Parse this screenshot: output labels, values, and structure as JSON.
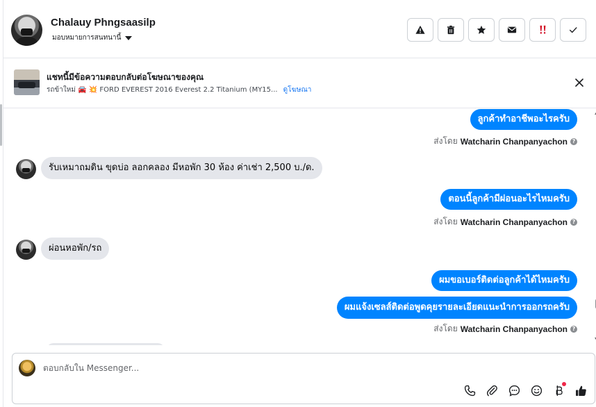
{
  "header": {
    "contact_name": "Chalauy Phngsaasilp",
    "assign_label": "มอบหมายการสนทนานี้",
    "actions": [
      {
        "name": "report",
        "icon": "warning-icon"
      },
      {
        "name": "delete",
        "icon": "trash-icon"
      },
      {
        "name": "star",
        "icon": "star-icon"
      },
      {
        "name": "mark-unread",
        "icon": "envelope-icon"
      },
      {
        "name": "follow-up",
        "icon": "exclamation-icon"
      },
      {
        "name": "mark-done",
        "icon": "check-icon"
      }
    ]
  },
  "ad_banner": {
    "title": "แชทนี้มีข้อความตอบกลับต่อโฆษณาของคุณ",
    "subtitle": "รถข้าใหม่ 🚘 💥 FORD EVEREST 2016 Everest 2.2 Titanium (MY15...",
    "link": "ดูโฆษณา"
  },
  "thread": {
    "messages": [
      {
        "dir": "out",
        "text": "ลูกค้าทำอาชีพอะไรครับ"
      },
      {
        "dir": "sent_by",
        "label": "ส่งโดย",
        "agent": "Watcharin Chanpanyachon"
      },
      {
        "dir": "in",
        "text": "รับเหมาถมดิน ขุดบ่อ ลอกคลอง มีหอพัก 30 ห้อง ค่าเช่า 2,500 บ./ด."
      },
      {
        "dir": "out",
        "text": "ตอนนี้ลูกค้ามีผ่อนอะไรไหมครับ"
      },
      {
        "dir": "sent_by",
        "label": "ส่งโดย",
        "agent": "Watcharin Chanpanyachon"
      },
      {
        "dir": "in",
        "text": "ผ่อนหอพัก/รถ"
      },
      {
        "dir": "out",
        "text": "ผมขอเบอร์ติดต่อลูกค้าได้ไหมครับ"
      },
      {
        "dir": "out",
        "text": "ผมแจ้งเซลส์ติดต่อพูดคุยรายละเอียดแนะนำการออกรถครับ"
      },
      {
        "dir": "sent_by",
        "label": "ส่งโดย",
        "agent": "Watcharin Chanpanyachon"
      }
    ]
  },
  "composer": {
    "placeholder": "ตอบกลับใน Messenger...",
    "tools": [
      "phone-icon",
      "paperclip-icon",
      "saved-reply-icon",
      "emoji-icon",
      "payment-icon",
      "thumbs-up-icon"
    ]
  },
  "colors": {
    "outgoing_bubble": "#0084ff",
    "incoming_bubble": "#e4e6eb",
    "link": "#1877f2",
    "follow_up_icon": "#d0021b"
  }
}
